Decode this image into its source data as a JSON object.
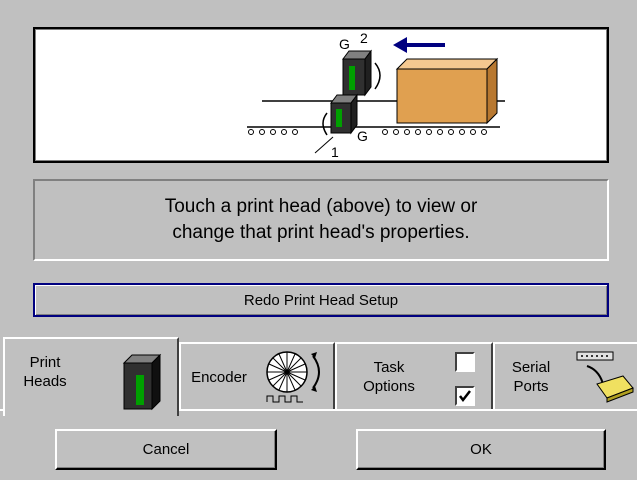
{
  "diagram": {
    "head1_number": "1",
    "head1_label": "G",
    "head2_number": "2",
    "head2_label": "G"
  },
  "message": {
    "line1": "Touch a print head (above) to view or",
    "line2": "change that print head's properties."
  },
  "redo_button": {
    "label": "Redo Print Head Setup"
  },
  "tabs": [
    {
      "line1": "Print",
      "line2": "Heads",
      "icon": "print-head-icon",
      "active": true
    },
    {
      "line1": "Encoder",
      "line2": "",
      "icon": "encoder-wheel-icon",
      "active": false
    },
    {
      "line1": "Task",
      "line2": "Options",
      "icon": "checkbox-icon",
      "active": false
    },
    {
      "line1": "Serial",
      "line2": "Ports",
      "icon": "serial-cable-icon",
      "active": false
    }
  ],
  "task_options": {
    "top_checked": false,
    "bottom_checked": true
  },
  "buttons": {
    "cancel": "Cancel",
    "ok": "OK"
  },
  "colors": {
    "box": "#e0a050",
    "arrow": "#000080",
    "head_stripe": "#00a000"
  }
}
